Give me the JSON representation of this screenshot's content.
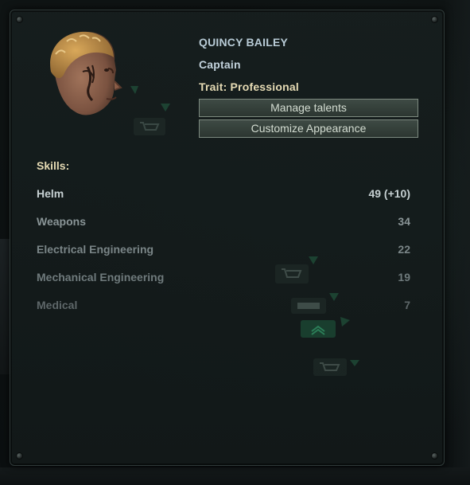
{
  "character": {
    "name": "QUINCY BAILEY",
    "role": "Captain",
    "trait": "Trait: Professional"
  },
  "buttons": {
    "manage_talents": "Manage talents",
    "customize_appearance": "Customize Appearance"
  },
  "skills": {
    "title": "Skills:",
    "items": [
      {
        "name": "Helm",
        "value": "49 (+10)",
        "color": "#c6d0d2"
      },
      {
        "name": "Weapons",
        "value": "34",
        "color": "#8a9597"
      },
      {
        "name": "Electrical Engineering",
        "value": "22",
        "color": "#7a8587"
      },
      {
        "name": "Mechanical Engineering",
        "value": "19",
        "color": "#6f7a7c"
      },
      {
        "name": "Medical",
        "value": "7",
        "color": "#5e6769"
      }
    ]
  },
  "colors": {
    "name": "#b8cbd6",
    "trait": "#e6dbb4",
    "accent_green": "#2b6b4d"
  },
  "icons": {
    "portrait": "character-portrait",
    "background": [
      "cart-icon",
      "bed-icon",
      "chevron-up-icon"
    ]
  }
}
